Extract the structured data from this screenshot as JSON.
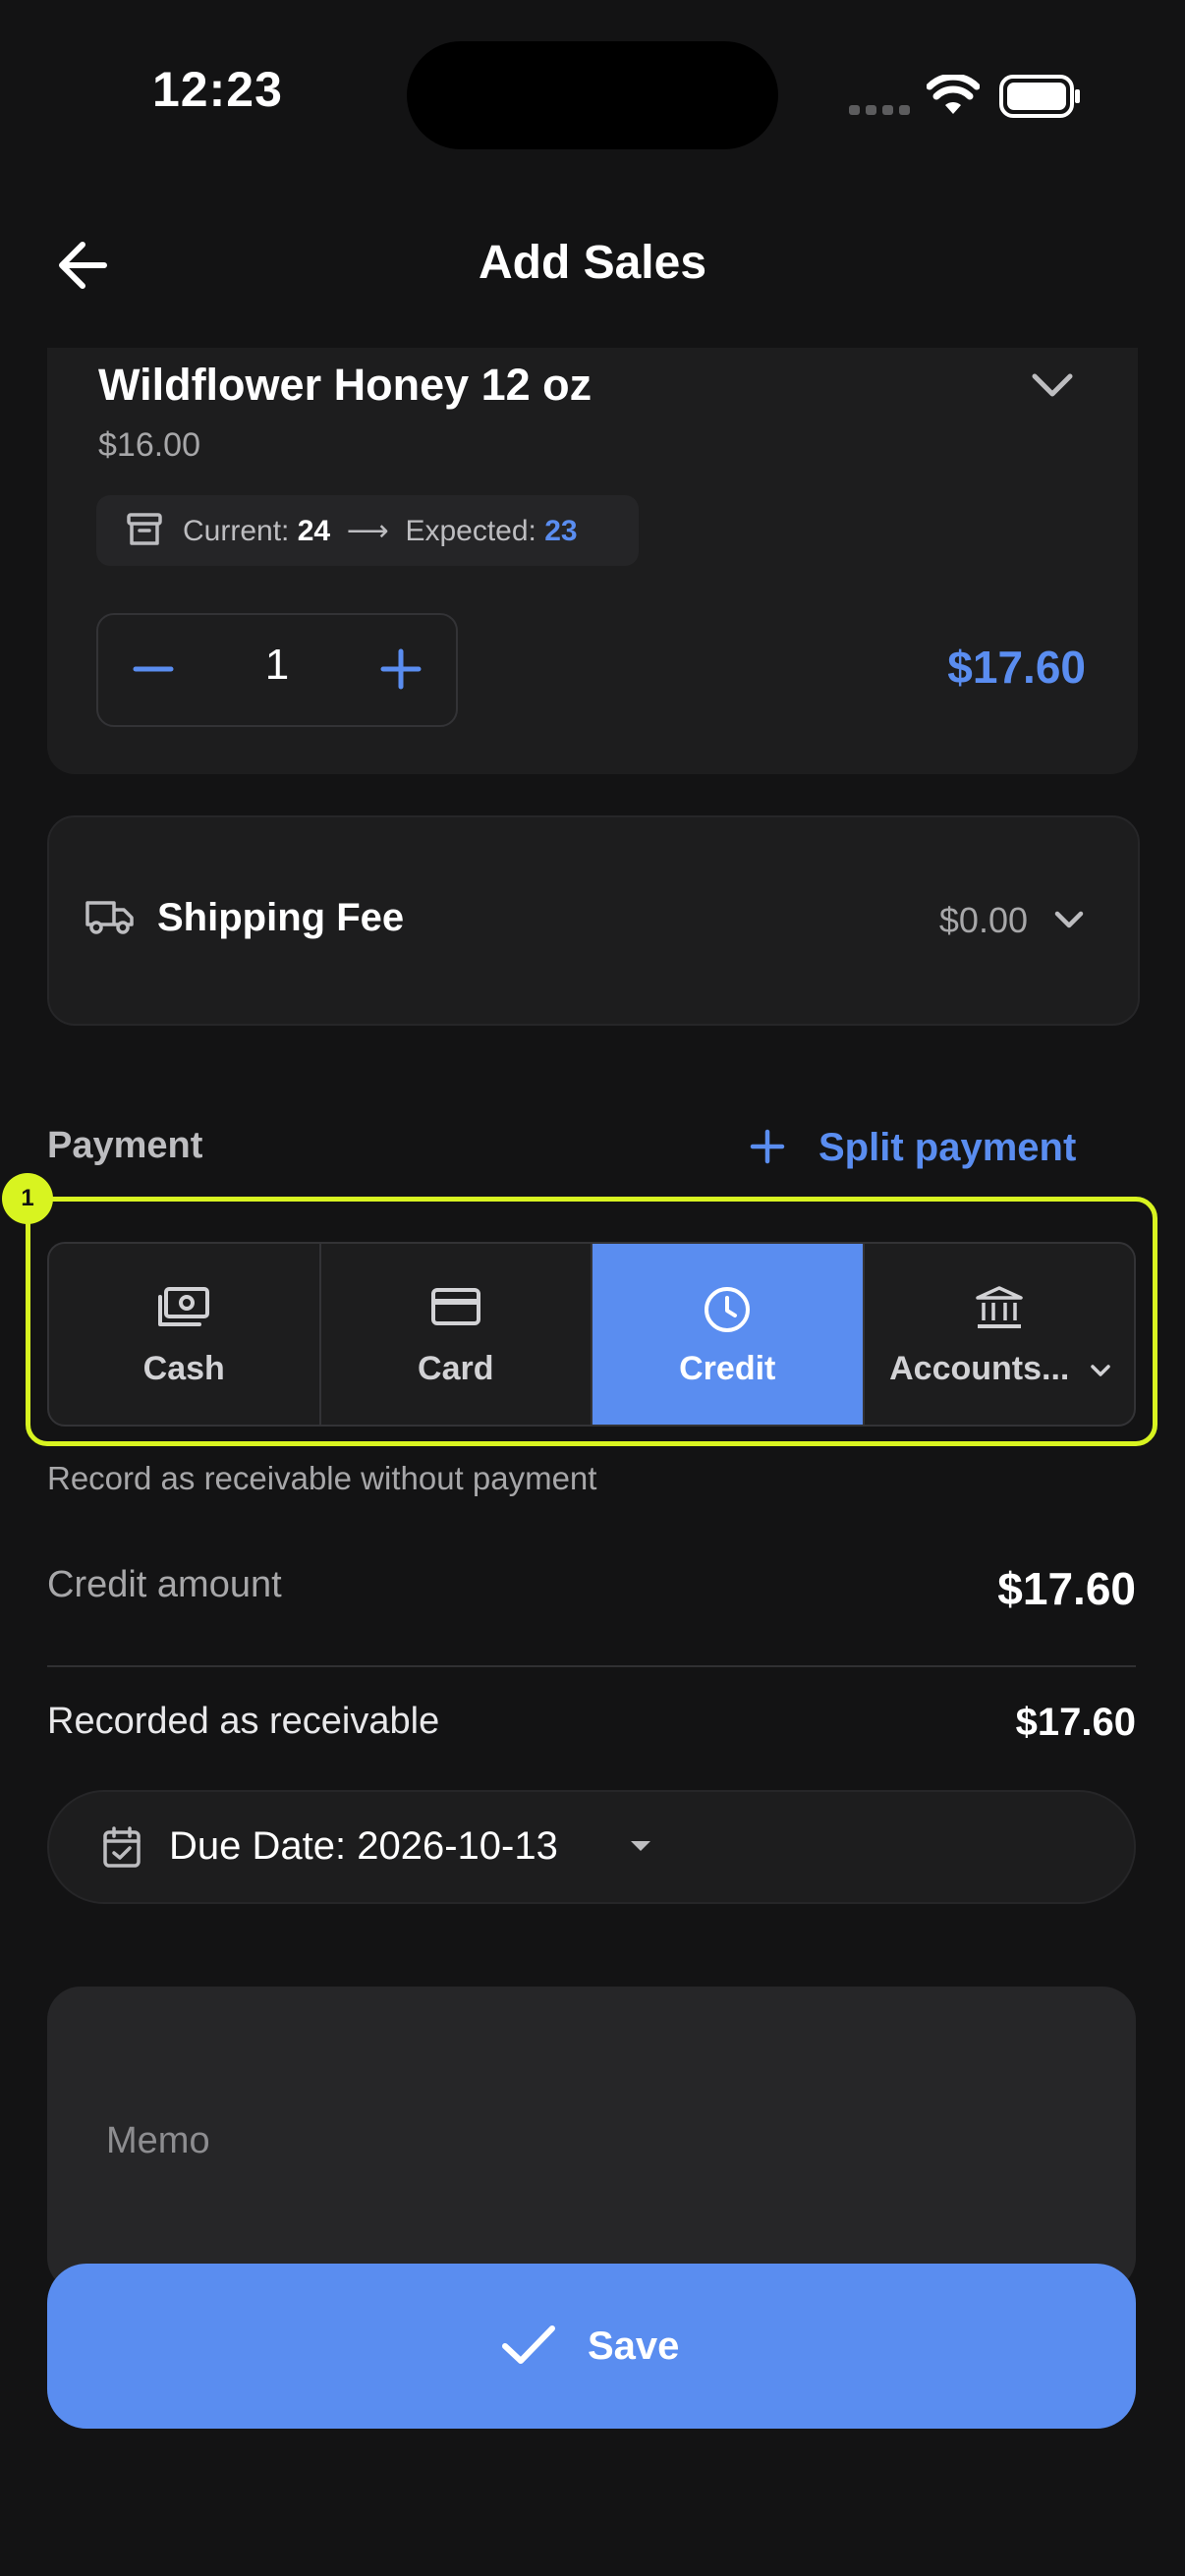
{
  "status_bar": {
    "time": "12:23"
  },
  "header": {
    "title": "Add Sales"
  },
  "product": {
    "name": "Wildflower Honey 12 oz",
    "price": "$16.00",
    "stock": {
      "current_label": "Current:",
      "current": "24",
      "expected_label": "Expected:",
      "expected": "23"
    },
    "quantity": "1",
    "line_total": "$17.60"
  },
  "shipping": {
    "label": "Shipping Fee",
    "value": "$0.00"
  },
  "payment": {
    "label": "Payment",
    "split_label": "Split payment",
    "methods": [
      {
        "label": "Cash",
        "icon": "cash-icon",
        "selected": false
      },
      {
        "label": "Card",
        "icon": "card-icon",
        "selected": false
      },
      {
        "label": "Credit",
        "icon": "clock-icon",
        "selected": true
      },
      {
        "label": "Accounts...",
        "icon": "bank-icon",
        "selected": false
      }
    ],
    "hint": "Record as receivable without payment",
    "highlight_badge": "1"
  },
  "credit": {
    "amount_label": "Credit amount",
    "amount_value": "$17.60",
    "receivable_label": "Recorded as receivable",
    "receivable_value": "$17.60",
    "due_date": "Due Date: 2026-10-13"
  },
  "memo": {
    "placeholder": "Memo"
  },
  "save": {
    "label": "Save"
  },
  "colors": {
    "accent": "#5a8df0",
    "background": "#131314",
    "card": "#1d1d1e",
    "highlight": "#d8f420"
  }
}
